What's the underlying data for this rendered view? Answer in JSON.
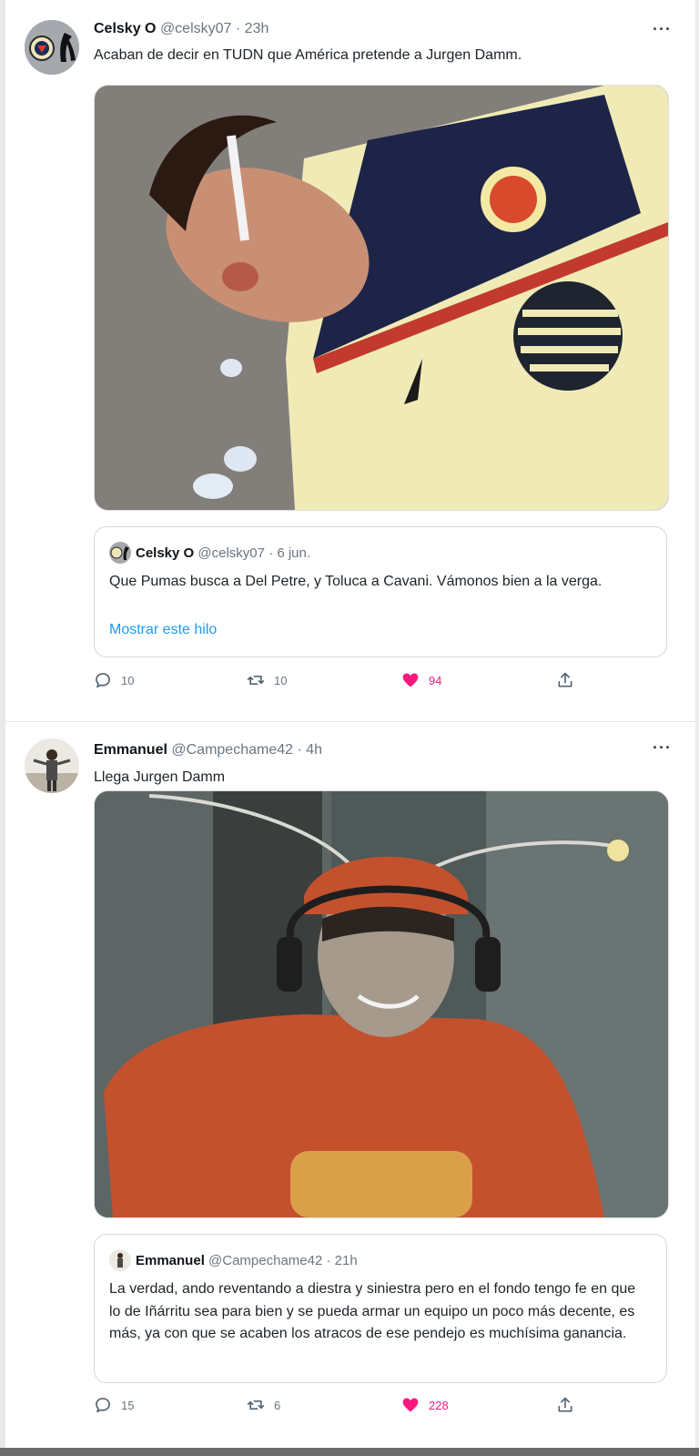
{
  "colors": {
    "accent": "#1d9bf0",
    "like": "#f91880",
    "muted": "#6b7681",
    "border": "#cfd9de"
  },
  "tweets": [
    {
      "name": "Celsky O",
      "handle": "@celsky07",
      "dot": "·",
      "time": "23h",
      "more": "···",
      "text": "Acaban de decir en TUDN que América pretende a Jurgen Damm.",
      "avatar_icon": "club-america-crest-icon",
      "media_desc": "photo",
      "quote": {
        "name": "Celsky O",
        "handle": "@celsky07",
        "dot": "·",
        "time": "6 jun.",
        "text": "Que Pumas busca a Del Petre, y Toluca a Cavani. Vámonos bien a la verga.",
        "link": "Mostrar este hilo"
      },
      "reply_count": "10",
      "retweet_count": "10",
      "like_count": "94",
      "liked": true
    },
    {
      "name": "Emmanuel",
      "handle": "@Campechame42",
      "dot": "·",
      "time": "4h",
      "more": "···",
      "text": "Llega Jurgen Damm",
      "avatar_icon": "person-avatar-icon",
      "media_desc": "photo",
      "quote": {
        "name": "Emmanuel",
        "handle": "@Campechame42",
        "dot": "·",
        "time": "21h",
        "text": "La verdad, ando reventando a diestra y siniestra pero en el fondo tengo fe en que lo de Iñárritu sea para bien y se pueda armar un equipo un poco más decente, es más, ya con que se acaben los atracos de ese pendejo es muchísima ganancia."
      },
      "reply_count": "15",
      "retweet_count": "6",
      "like_count": "228",
      "liked": true
    }
  ]
}
